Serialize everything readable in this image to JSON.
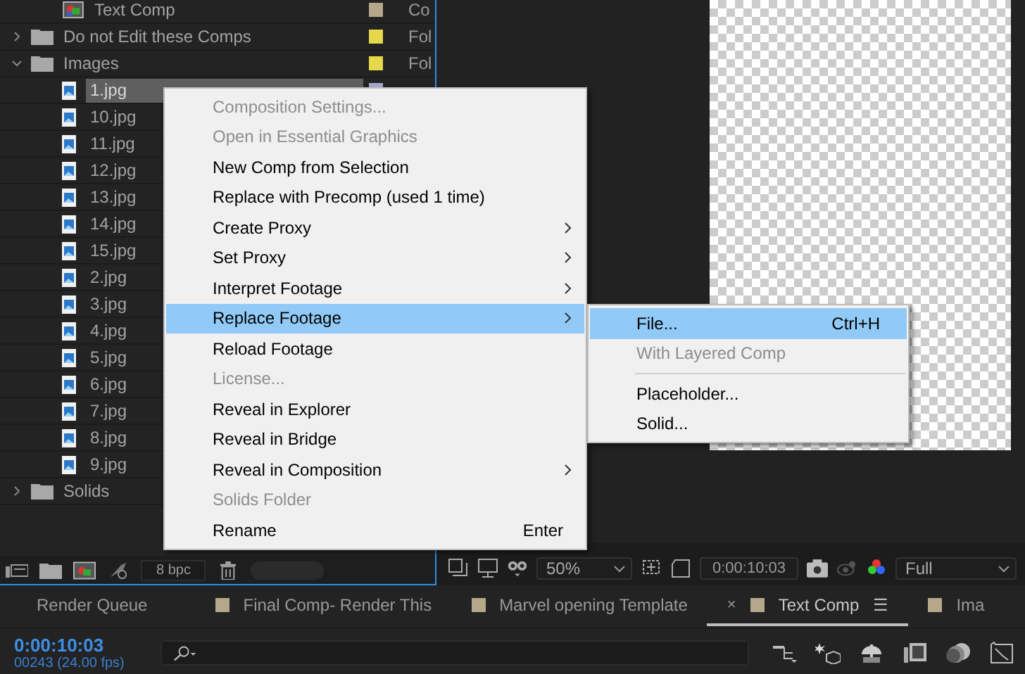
{
  "project": {
    "items": [
      {
        "children": [
          {
            "kind": "comp",
            "name": "Text Comp",
            "color": "#b5a78a",
            "type": "Co",
            "selected": false
          }
        ]
      },
      {
        "kind": "folder",
        "name": "Do not Edit these Comps",
        "expanded": false,
        "color": "#e5d84a",
        "type": "Fol",
        "selected": false
      },
      {
        "kind": "folder",
        "name": "Images",
        "expanded": true,
        "color": "#e5d84a",
        "type": "Fol",
        "selected": false,
        "children": [
          {
            "kind": "image",
            "name": "1.jpg",
            "color": "#a9a7c9",
            "selected": true
          },
          {
            "kind": "image",
            "name": "10.jpg",
            "selected": false
          },
          {
            "kind": "image",
            "name": "11.jpg",
            "selected": false
          },
          {
            "kind": "image",
            "name": "12.jpg",
            "selected": false
          },
          {
            "kind": "image",
            "name": "13.jpg",
            "selected": false
          },
          {
            "kind": "image",
            "name": "14.jpg",
            "selected": false
          },
          {
            "kind": "image",
            "name": "15.jpg",
            "selected": false
          },
          {
            "kind": "image",
            "name": "2.jpg",
            "selected": false
          },
          {
            "kind": "image",
            "name": "3.jpg",
            "selected": false
          },
          {
            "kind": "image",
            "name": "4.jpg",
            "selected": false
          },
          {
            "kind": "image",
            "name": "5.jpg",
            "selected": false
          },
          {
            "kind": "image",
            "name": "6.jpg",
            "selected": false
          },
          {
            "kind": "image",
            "name": "7.jpg",
            "selected": false
          },
          {
            "kind": "image",
            "name": "8.jpg",
            "selected": false
          },
          {
            "kind": "image",
            "name": "9.jpg",
            "selected": false
          }
        ]
      },
      {
        "kind": "folder",
        "name": "Solids",
        "expanded": false,
        "selected": false
      }
    ],
    "bit_depth": "8 bpc"
  },
  "viewer": {
    "zoom": "50%",
    "timecode": "0:00:10:03",
    "resolution": "Full"
  },
  "context_menu": {
    "items": [
      {
        "label": "Composition Settings...",
        "disabled": true,
        "submenu": false,
        "selected": false
      },
      {
        "label": "Open in Essential Graphics",
        "disabled": true,
        "submenu": false,
        "selected": false
      },
      {
        "label": "New Comp from Selection",
        "disabled": false,
        "submenu": false,
        "selected": false
      },
      {
        "label": "Replace with Precomp (used 1 time)",
        "disabled": false,
        "submenu": false,
        "selected": false
      },
      {
        "label": "Create Proxy",
        "disabled": false,
        "submenu": true,
        "selected": false
      },
      {
        "label": "Set Proxy",
        "disabled": false,
        "submenu": true,
        "selected": false
      },
      {
        "label": "Interpret Footage",
        "disabled": false,
        "submenu": true,
        "selected": false
      },
      {
        "label": "Replace Footage",
        "disabled": false,
        "submenu": true,
        "selected": true
      },
      {
        "label": "Reload Footage",
        "disabled": false,
        "submenu": false,
        "selected": false
      },
      {
        "label": "License...",
        "disabled": true,
        "submenu": false,
        "selected": false
      },
      {
        "label": "Reveal in Explorer",
        "disabled": false,
        "submenu": false,
        "selected": false
      },
      {
        "label": "Reveal in Bridge",
        "disabled": false,
        "submenu": false,
        "selected": false
      },
      {
        "label": "Reveal in Composition",
        "disabled": false,
        "submenu": true,
        "selected": false
      },
      {
        "label": "Solids Folder",
        "disabled": true,
        "submenu": false,
        "selected": false
      },
      {
        "label": "Rename",
        "shortcut": "Enter",
        "disabled": false,
        "submenu": false,
        "selected": false
      }
    ]
  },
  "submenu": {
    "items": [
      {
        "kind": "item",
        "label": "File...",
        "shortcut": "Ctrl+H",
        "disabled": false,
        "selected": true
      },
      {
        "kind": "item",
        "label": "With Layered Comp",
        "disabled": true,
        "selected": false
      },
      {
        "kind": "separator"
      },
      {
        "kind": "item",
        "label": "Placeholder...",
        "disabled": false,
        "selected": false
      },
      {
        "kind": "item",
        "label": "Solid...",
        "disabled": false,
        "selected": false
      }
    ]
  },
  "tabs": [
    {
      "label": "Render Queue",
      "selected": false
    },
    {
      "label": "Final Comp- Render This",
      "color": "#b5a78a",
      "selected": false
    },
    {
      "label": "Marvel opening Template",
      "color": "#b5a78a",
      "selected": false
    },
    {
      "label": "Text Comp",
      "color": "#b5a78a",
      "close": "×",
      "menu": "☰",
      "selected": true
    },
    {
      "label": "Ima",
      "color": "#b5a78a",
      "selected": false
    }
  ],
  "timeline": {
    "timecode": "0:00:10:03",
    "frames": "00243 (24.00 fps)"
  }
}
